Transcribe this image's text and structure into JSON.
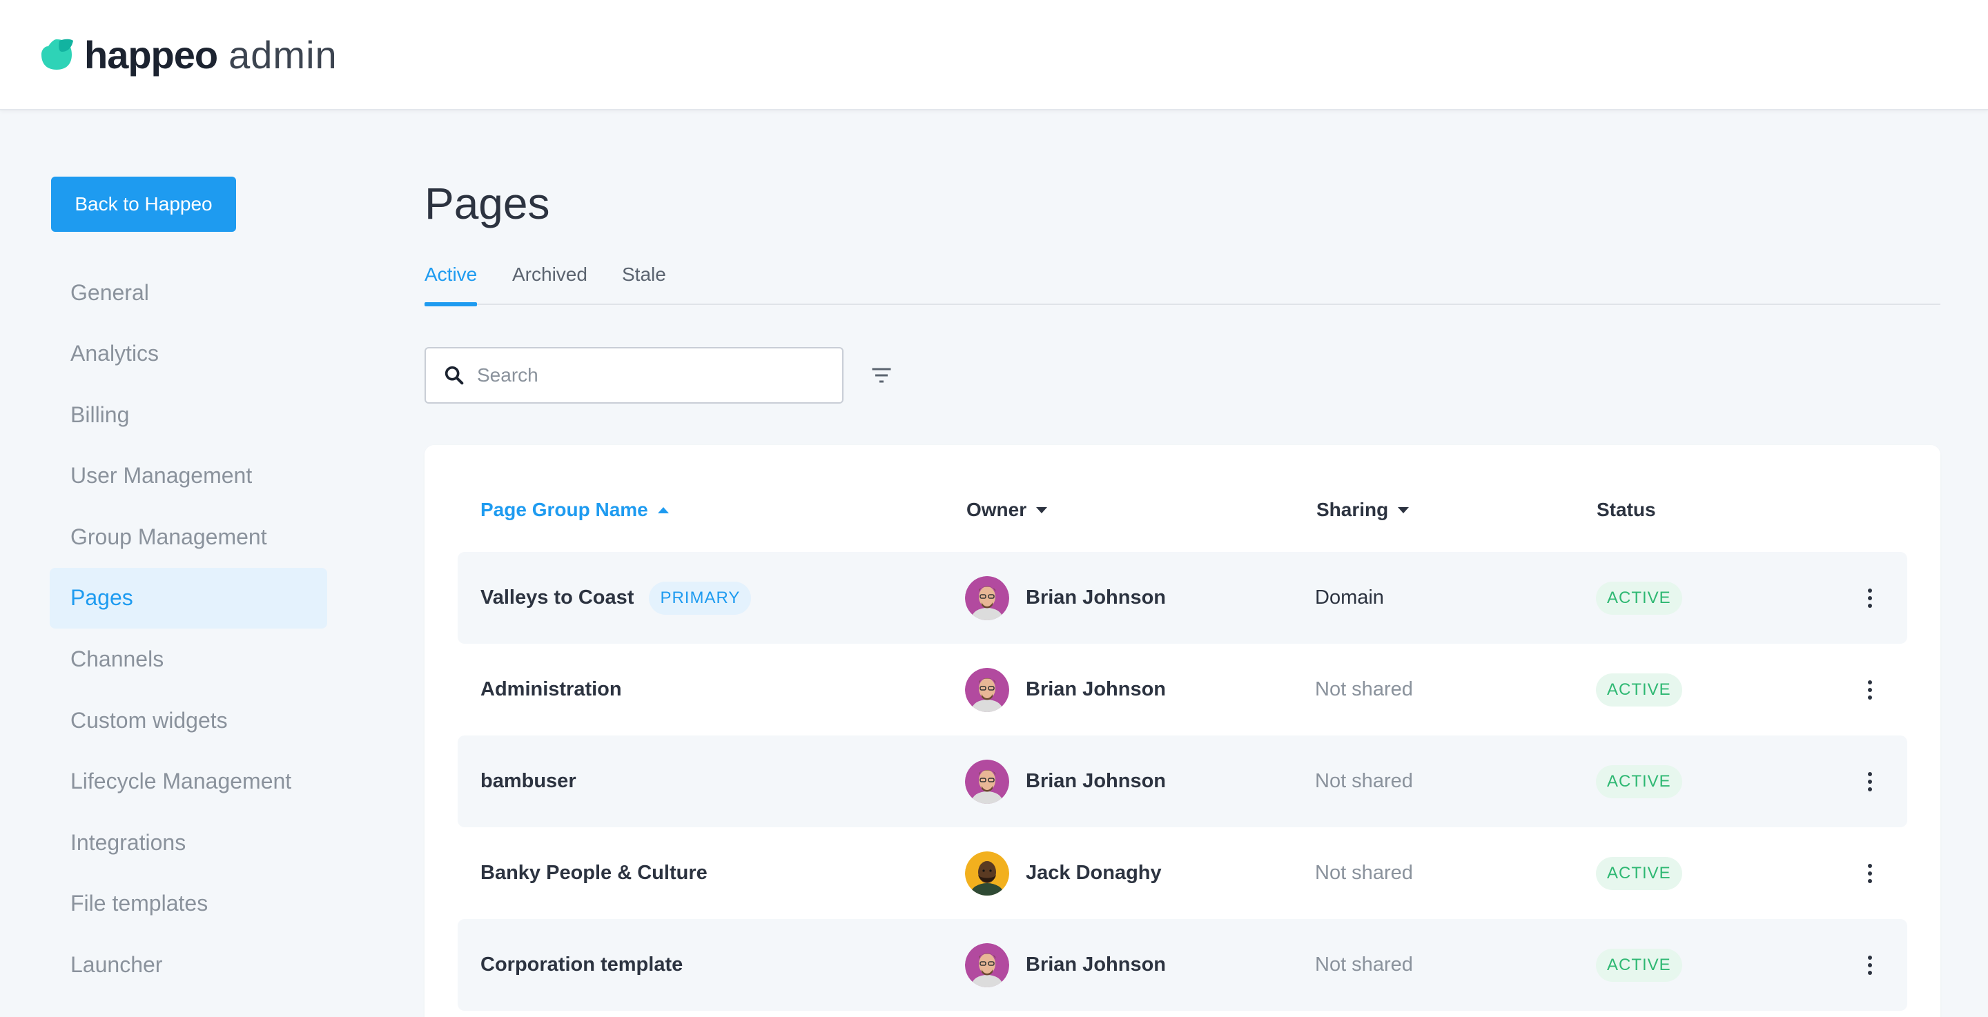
{
  "brand": {
    "name": "happeo",
    "suffix": "admin",
    "accent_color": "#1e9bf0",
    "leaf_color": "#2ed3b7"
  },
  "sidebar": {
    "back_button": "Back to Happeo",
    "items": [
      {
        "label": "General",
        "active": false
      },
      {
        "label": "Analytics",
        "active": false
      },
      {
        "label": "Billing",
        "active": false
      },
      {
        "label": "User Management",
        "active": false
      },
      {
        "label": "Group Management",
        "active": false
      },
      {
        "label": "Pages",
        "active": true
      },
      {
        "label": "Channels",
        "active": false
      },
      {
        "label": "Custom widgets",
        "active": false
      },
      {
        "label": "Lifecycle Management",
        "active": false
      },
      {
        "label": "Integrations",
        "active": false
      },
      {
        "label": "File templates",
        "active": false
      },
      {
        "label": "Launcher",
        "active": false
      }
    ]
  },
  "main": {
    "title": "Pages",
    "tabs": [
      {
        "label": "Active",
        "active": true
      },
      {
        "label": "Archived",
        "active": false
      },
      {
        "label": "Stale",
        "active": false
      }
    ],
    "search": {
      "placeholder": "Search",
      "value": ""
    },
    "filter_icon": "filter-icon"
  },
  "table": {
    "columns": [
      {
        "label": "Page Group Name",
        "sort": "ascending"
      },
      {
        "label": "Owner",
        "sort": "dropdown"
      },
      {
        "label": "Sharing",
        "sort": "dropdown"
      },
      {
        "label": "Status",
        "sort": "none"
      }
    ],
    "rows": [
      {
        "name": "Valleys to Coast",
        "badge": "PRIMARY",
        "owner": "Brian Johnson",
        "avatar": "brian",
        "sharing": "Domain",
        "status": "ACTIVE"
      },
      {
        "name": "Administration",
        "badge": "",
        "owner": "Brian Johnson",
        "avatar": "brian",
        "sharing": "Not shared",
        "status": "ACTIVE"
      },
      {
        "name": "bambuser",
        "badge": "",
        "owner": "Brian Johnson",
        "avatar": "brian",
        "sharing": "Not shared",
        "status": "ACTIVE"
      },
      {
        "name": "Banky People & Culture",
        "badge": "",
        "owner": "Jack Donaghy",
        "avatar": "jack",
        "sharing": "Not shared",
        "status": "ACTIVE"
      },
      {
        "name": "Corporation template",
        "badge": "",
        "owner": "Brian Johnson",
        "avatar": "brian",
        "sharing": "Not shared",
        "status": "ACTIVE"
      }
    ]
  }
}
